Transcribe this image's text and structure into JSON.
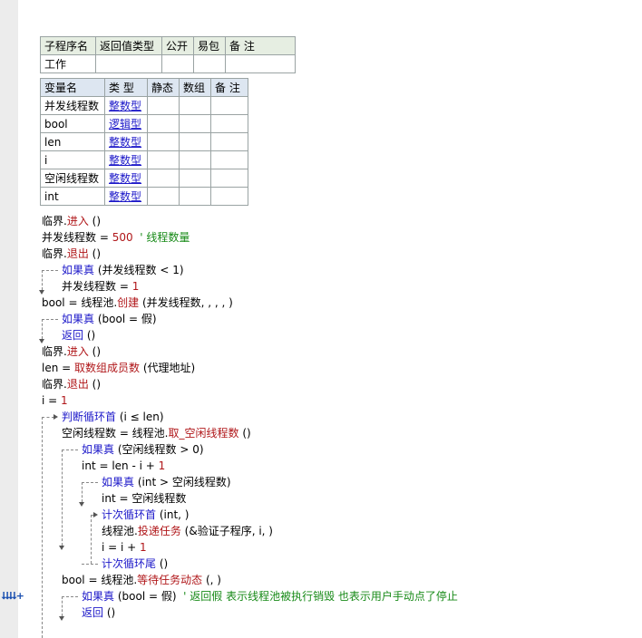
{
  "sub_table": {
    "headers": [
      "子程序名",
      "返回值类型",
      "公开",
      "易包",
      "备 注"
    ],
    "row": [
      "工作",
      "",
      "",
      "",
      ""
    ]
  },
  "var_table": {
    "headers": [
      "变量名",
      "类 型",
      "静态",
      "数组",
      "备 注"
    ],
    "rows": [
      {
        "name": "并发线程数",
        "type": "整数型"
      },
      {
        "name": "bool",
        "type": "逻辑型"
      },
      {
        "name": "len",
        "type": "整数型"
      },
      {
        "name": "i",
        "type": "整数型"
      },
      {
        "name": "空闲线程数",
        "type": "整数型"
      },
      {
        "name": "int",
        "type": "整数型"
      }
    ]
  },
  "code": {
    "l1": {
      "a": "临界.",
      "b": "进入",
      "c": " ()"
    },
    "l2": {
      "a": "并发线程数 = ",
      "b": "500",
      "c": "  ' 线程数量"
    },
    "l3": {
      "a": "临界.",
      "b": "退出",
      "c": " ()"
    },
    "l4": {
      "a": "如果真",
      "b": " (并发线程数 < 1)"
    },
    "l5": {
      "a": "并发线程数 = ",
      "b": "1"
    },
    "l6": {
      "a": "bool = 线程池.",
      "b": "创建",
      "c": " (并发线程数, , , , )"
    },
    "l7": {
      "a": "如果真",
      "b": " (bool = 假)"
    },
    "l8": {
      "a": "返回",
      "b": " ()"
    },
    "l9": {
      "a": "临界.",
      "b": "进入",
      "c": " ()"
    },
    "l10": {
      "a": "len = ",
      "b": "取数组成员数",
      "c": " (代理地址)"
    },
    "l11": {
      "a": "临界.",
      "b": "退出",
      "c": " ()"
    },
    "l12": {
      "a": "i = ",
      "b": "1"
    },
    "l13": {
      "a": "判断循环首",
      "b": " (i ≤ len)"
    },
    "l14": {
      "a": "空闲线程数 = 线程池.",
      "b": "取_空闲线程数",
      "c": " ()"
    },
    "l15": {
      "a": "如果真",
      "b": " (空闲线程数 > 0)"
    },
    "l16": {
      "a": "int = len - i + ",
      "b": "1"
    },
    "l17": {
      "a": "如果真",
      "b": " (int > 空闲线程数)"
    },
    "l18": {
      "a": "int = 空闲线程数"
    },
    "l19": {
      "a": "计次循环首",
      "b": " (int, )"
    },
    "l20": {
      "a": "线程池.",
      "b": "投递任务",
      "c": " (&验证子程序, i, )"
    },
    "l21": {
      "a": "i = i + ",
      "b": "1"
    },
    "l22": {
      "a": "计次循环尾",
      "b": " ()"
    },
    "l23": {
      "a": "bool = 线程池.",
      "b": "等待任务动态",
      "c": " (, )"
    },
    "l24": {
      "a": "如果真",
      "b": " (bool = 假)",
      "c": "  ' 返回假 表示线程池被执行销毁 也表示用户手动点了停止"
    },
    "l25": {
      "a": "返回",
      "b": " ()"
    }
  },
  "gutter_icons": "⮇⮇+",
  "colors": {
    "keyword": "#1c18c9",
    "method": "#b0171a",
    "comment": "#178a17",
    "sub_header_bg": "#e6eee2",
    "var_header_bg": "#dde6f1"
  }
}
